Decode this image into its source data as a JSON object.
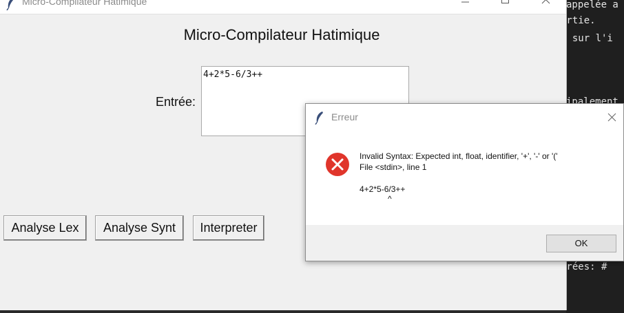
{
  "terminal": {
    "lines": [
      "appelée a",
      "ortie.",
      "t sur l'i",
      "",
      "",
      "",
      "ipalement",
      "",
      "",
      "",
      "",
      "",
      "",
      "",
      "",
      "",
      "",
      "",
      "érées: #"
    ]
  },
  "main_window": {
    "title": "Micro-Compilateur Hatimique",
    "heading": "Micro-Compilateur Hatimique",
    "entry_label": "Entrée:",
    "entry_value": "4+2*5-6/3++",
    "buttons": {
      "lex": "Analyse Lex",
      "synt": "Analyse Synt",
      "interp": "Interpreter"
    }
  },
  "dialog": {
    "title": "Erreur",
    "message_line1": "Invalid Syntax: Expected int, float, identifier, '+', '-' or '('",
    "message_line2": "File <stdin>, line 1",
    "code_line": "4+2*5-6/3++",
    "caret": "^",
    "ok_label": "OK"
  },
  "colors": {
    "error_red": "#e0352b",
    "window_bg": "#f0f0f0",
    "terminal_bg": "#1f1f1f"
  },
  "icons": [
    "feather-icon",
    "minimize-icon",
    "maximize-icon",
    "close-icon",
    "error-icon"
  ]
}
